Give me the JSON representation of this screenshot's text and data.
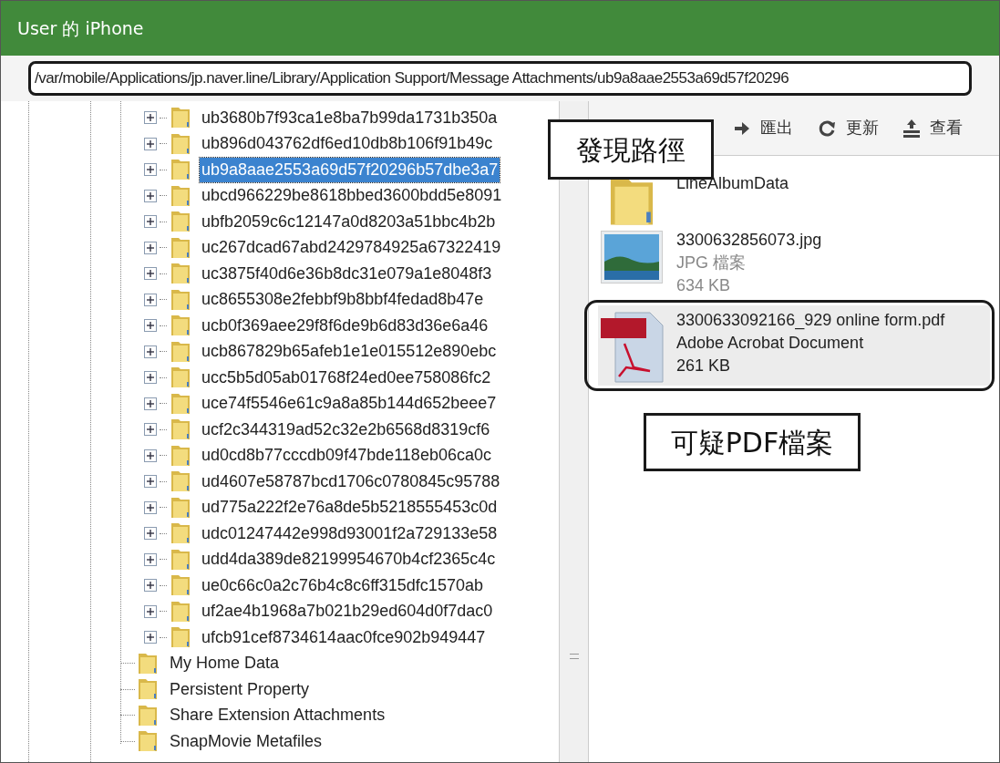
{
  "window": {
    "title": "User 的 iPhone"
  },
  "path_field": {
    "value": "/var/mobile/Applications/jp.naver.line/Library/Application Support/Message Attachments/ub9a8aae2553a69d57f20296"
  },
  "tree": {
    "subfolders": [
      {
        "label": "ub3680b7f93ca1e8ba7b99da1731b350a",
        "selected": false,
        "expanded": false
      },
      {
        "label": "ub896d043762df6ed10db8b106f91b49c",
        "selected": false,
        "expanded": false
      },
      {
        "label": "ub9a8aae2553a69d57f20296b57dbe3a7",
        "selected": true,
        "expanded": false
      },
      {
        "label": "ubcd966229be8618bbed3600bdd5e8091",
        "selected": false,
        "expanded": false
      },
      {
        "label": "ubfb2059c6c12147a0d8203a51bbc4b2b",
        "selected": false,
        "expanded": false
      },
      {
        "label": "uc267dcad67abd2429784925a67322419",
        "selected": false,
        "expanded": false
      },
      {
        "label": "uc3875f40d6e36b8dc31e079a1e8048f3",
        "selected": false,
        "expanded": false
      },
      {
        "label": "uc8655308e2febbf9b8bbf4fedad8b47e",
        "selected": false,
        "expanded": false
      },
      {
        "label": "ucb0f369aee29f8f6de9b6d83d36e6a46",
        "selected": false,
        "expanded": false
      },
      {
        "label": "ucb867829b65afeb1e1e015512e890ebc",
        "selected": false,
        "expanded": false
      },
      {
        "label": "ucc5b5d05ab01768f24ed0ee758086fc2",
        "selected": false,
        "expanded": false
      },
      {
        "label": "uce74f5546e61c9a8a85b144d652beee7",
        "selected": false,
        "expanded": false
      },
      {
        "label": "ucf2c344319ad52c32e2b6568d8319cf6",
        "selected": false,
        "expanded": false
      },
      {
        "label": "ud0cd8b77cccdb09f47bde118eb06ca0c",
        "selected": false,
        "expanded": false
      },
      {
        "label": "ud4607e58787bcd1706c0780845c95788",
        "selected": false,
        "expanded": false
      },
      {
        "label": "ud775a222f2e76a8de5b5218555453c0d",
        "selected": false,
        "expanded": false
      },
      {
        "label": "udc01247442e998d93001f2a729133e58",
        "selected": false,
        "expanded": false
      },
      {
        "label": "udd4da389de82199954670b4cf2365c4c",
        "selected": false,
        "expanded": false
      },
      {
        "label": "ue0c66c0a2c76b4c8c6ff315dfc1570ab",
        "selected": false,
        "expanded": false
      },
      {
        "label": "uf2ae4b1968a7b021b29ed604d0f7dac0",
        "selected": false,
        "expanded": false
      },
      {
        "label": "ufcb91cef8734614aac0fce902b949447",
        "selected": false,
        "expanded": false
      }
    ],
    "folders": [
      {
        "label": "My Home Data",
        "selected": false
      },
      {
        "label": "Persistent Property",
        "selected": false
      },
      {
        "label": "Share Extension Attachments",
        "selected": false
      },
      {
        "label": "SnapMovie Metafiles",
        "selected": false
      }
    ]
  },
  "toolbar": [
    {
      "kind": "export",
      "label": "匯出"
    },
    {
      "kind": "refresh",
      "label": "更新"
    },
    {
      "kind": "view",
      "label": "查看"
    }
  ],
  "files": [
    {
      "kind": "folder",
      "name": "LineAlbumData",
      "selected": false
    },
    {
      "kind": "image",
      "name": "3300632856073.jpg",
      "type": "JPG 檔案",
      "size": "634 KB",
      "selected": false
    },
    {
      "kind": "pdf",
      "name": "3300633092166_929 online form.pdf",
      "type": "Adobe Acrobat Document",
      "size": "261 KB",
      "selected": true
    }
  ],
  "annotations": [
    {
      "kind": "path",
      "text": "發現路徑"
    },
    {
      "kind": "file",
      "text": "可疑PDF檔案"
    }
  ]
}
